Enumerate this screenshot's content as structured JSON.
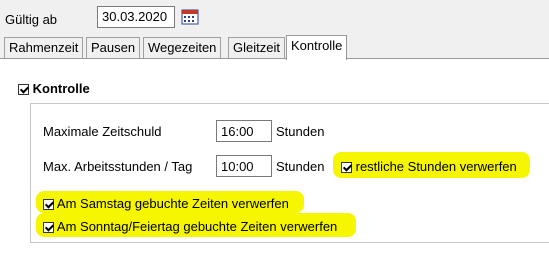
{
  "header": {
    "valid_label": "Gültig ab",
    "date_value": "30.03.2020"
  },
  "tabs": [
    {
      "label": "Rahmenzeit"
    },
    {
      "label": "Pausen"
    },
    {
      "label": "Wegezeiten"
    },
    {
      "label": "Gleitzeit"
    },
    {
      "label": "Kontrolle",
      "active": true
    }
  ],
  "kontrolle": {
    "title": "Kontrolle",
    "checked": true,
    "max_debt_label": "Maximale Zeitschuld",
    "max_debt_value": "16:00",
    "max_debt_unit": "Stunden",
    "max_hours_label": "Max. Arbeitsstunden / Tag",
    "max_hours_value": "10:00",
    "max_hours_unit": "Stunden",
    "discard_remaining_label": "restliche Stunden verwerfen",
    "discard_remaining_checked": true,
    "saturday_label": "Am Samstag gebuchte Zeiten verwerfen",
    "saturday_checked": true,
    "sunday_label": "Am Sonntag/Feiertag gebuchte Zeiten verwerfen",
    "sunday_checked": true
  },
  "colors": {
    "highlight": "#f6f600"
  }
}
